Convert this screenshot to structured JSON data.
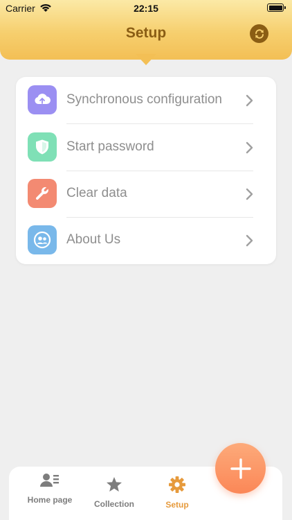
{
  "status_bar": {
    "carrier": "Carrier",
    "time": "22:15"
  },
  "header": {
    "title": "Setup",
    "sync_icon": "refresh-icon"
  },
  "settings": {
    "items": [
      {
        "label": "Synchronous configuration",
        "icon": "cloud-upload-icon",
        "color": "#9b8ff2"
      },
      {
        "label": "Start password",
        "icon": "shield-icon",
        "color": "#7fe0b6"
      },
      {
        "label": "Clear data",
        "icon": "wrench-icon",
        "color": "#f38a72"
      },
      {
        "label": "About Us",
        "icon": "people-icon",
        "color": "#79b8ea"
      }
    ]
  },
  "tabbar": {
    "tabs": [
      {
        "label": "Home page",
        "icon": "contact-card-icon"
      },
      {
        "label": "Collection",
        "icon": "star-icon"
      },
      {
        "label": "Setup",
        "icon": "gear-icon",
        "active": true
      }
    ],
    "fab_icon": "plus-icon",
    "accent": "#e69a3c"
  }
}
